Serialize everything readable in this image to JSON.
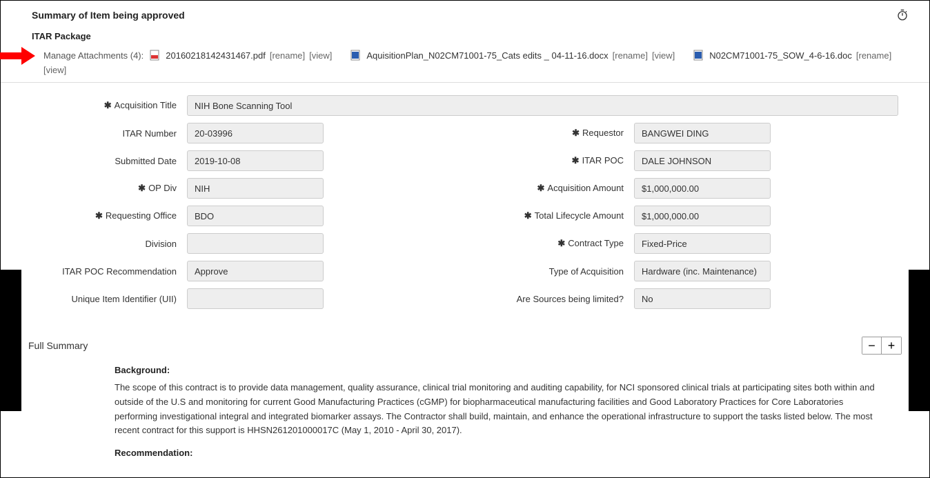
{
  "header": {
    "summary_title": "Summary of Item being approved",
    "package_title": "ITAR Package"
  },
  "attachments": {
    "label": "Manage Attachments (4):",
    "items": [
      {
        "name": "20160218142431467.pdf",
        "type": "pdf",
        "rename": "[rename]",
        "view": "[view]"
      },
      {
        "name": "AquisitionPlan_N02CM71001-75_Cats edits _ 04-11-16.docx",
        "type": "doc",
        "rename": "[rename]",
        "view": "[view]"
      },
      {
        "name": "N02CM71001-75_SOW_4-6-16.doc",
        "type": "doc",
        "rename": "[rename]",
        "view": "[view]"
      }
    ]
  },
  "fields": {
    "acquisition_title": {
      "label": "Acquisition Title",
      "value": "NIH Bone Scanning Tool",
      "required": true
    },
    "itar_number": {
      "label": "ITAR Number",
      "value": "20-03996",
      "required": false
    },
    "submitted_date": {
      "label": "Submitted Date",
      "value": "2019-10-08",
      "required": false
    },
    "op_div": {
      "label": "OP Div",
      "value": "NIH",
      "required": true
    },
    "requesting_office": {
      "label": "Requesting Office",
      "value": "BDO",
      "required": true
    },
    "division": {
      "label": "Division",
      "value": "",
      "required": false
    },
    "itar_poc_rec": {
      "label": "ITAR POC Recommendation",
      "value": "Approve",
      "required": false
    },
    "uii": {
      "label": "Unique Item Identifier (UII)",
      "value": "",
      "required": false
    },
    "requestor": {
      "label": "Requestor",
      "value": "BANGWEI DING",
      "required": true
    },
    "itar_poc": {
      "label": "ITAR POC",
      "value": "DALE JOHNSON",
      "required": true
    },
    "acquisition_amount": {
      "label": "Acquisition Amount",
      "value": "$1,000,000.00",
      "required": true
    },
    "lifecycle_amount": {
      "label": "Total Lifecycle Amount",
      "value": "$1,000,000.00",
      "required": true
    },
    "contract_type": {
      "label": "Contract Type",
      "value": "Fixed-Price",
      "required": true
    },
    "acquisition_type": {
      "label": "Type of Acquisition",
      "value": "Hardware (inc. Maintenance)",
      "required": false
    },
    "sources_limited": {
      "label": "Are Sources being limited?",
      "value": "No",
      "required": false
    }
  },
  "full_summary": {
    "title": "Full Summary",
    "background_heading": "Background:",
    "background_text": "The scope of this contract is to provide data management, quality assurance, clinical trial monitoring and auditing capability, for NCI sponsored clinical trials at participating sites both within and outside of the U.S and monitoring for current Good Manufacturing Practices (cGMP) for biopharmaceutical manufacturing facilities and Good Laboratory Practices for Core Laboratories performing investigational integral and integrated biomarker assays.  The Contractor shall build, maintain, and enhance the operational infrastructure to support the tasks listed below.  The most recent contract for this support is HHSN261201000017C (May 1, 2010 - April 30, 2017).",
    "recommendation_heading": "Recommendation:"
  },
  "required_mark": "✱"
}
